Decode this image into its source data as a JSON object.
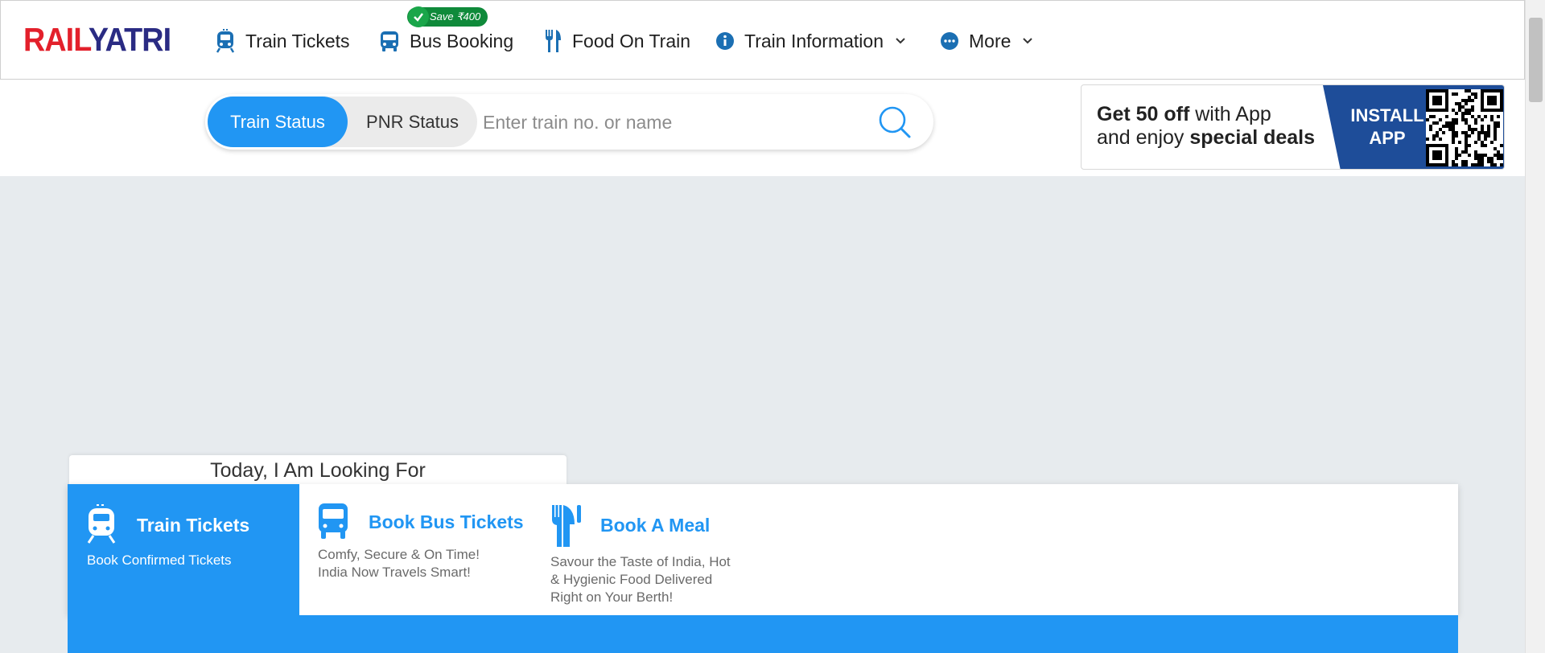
{
  "logo": {
    "part1": "RAIL",
    "part2": "YATRI"
  },
  "nav": {
    "train_tickets": "Train Tickets",
    "bus_booking": "Bus Booking",
    "food_on_train": "Food On Train",
    "train_information": "Train Information",
    "more": "More",
    "save_badge": "Save ₹400"
  },
  "search": {
    "tab_active": "Train Status",
    "tab_inactive": "PNR Status",
    "placeholder": "Enter train no. or name"
  },
  "promo": {
    "line1_bold": "Get 50 off",
    "line1_rest": " with App",
    "line2_rest": "and enjoy ",
    "line2_bold": "special deals",
    "install_line1": "INSTALL",
    "install_line2": "APP"
  },
  "looking_for": "Today, I Am Looking For",
  "cards": [
    {
      "title": "Train Tickets",
      "subtitle": "Book Confirmed Tickets"
    },
    {
      "title": "Book Bus Tickets",
      "sub1": "Comfy, Secure & On Time!",
      "sub2": "India Now Travels Smart!"
    },
    {
      "title": "Book A Meal",
      "sub1": "Savour the Taste of India, Hot",
      "sub2": "& Hygienic Food Delivered",
      "sub3": "Right on Your Berth!"
    }
  ],
  "colors": {
    "brand_red": "#e3202b",
    "brand_navy": "#2a2b83",
    "accent_blue": "#2196f3",
    "install_blue": "#1e4d99",
    "save_green": "#0f8a3a"
  }
}
